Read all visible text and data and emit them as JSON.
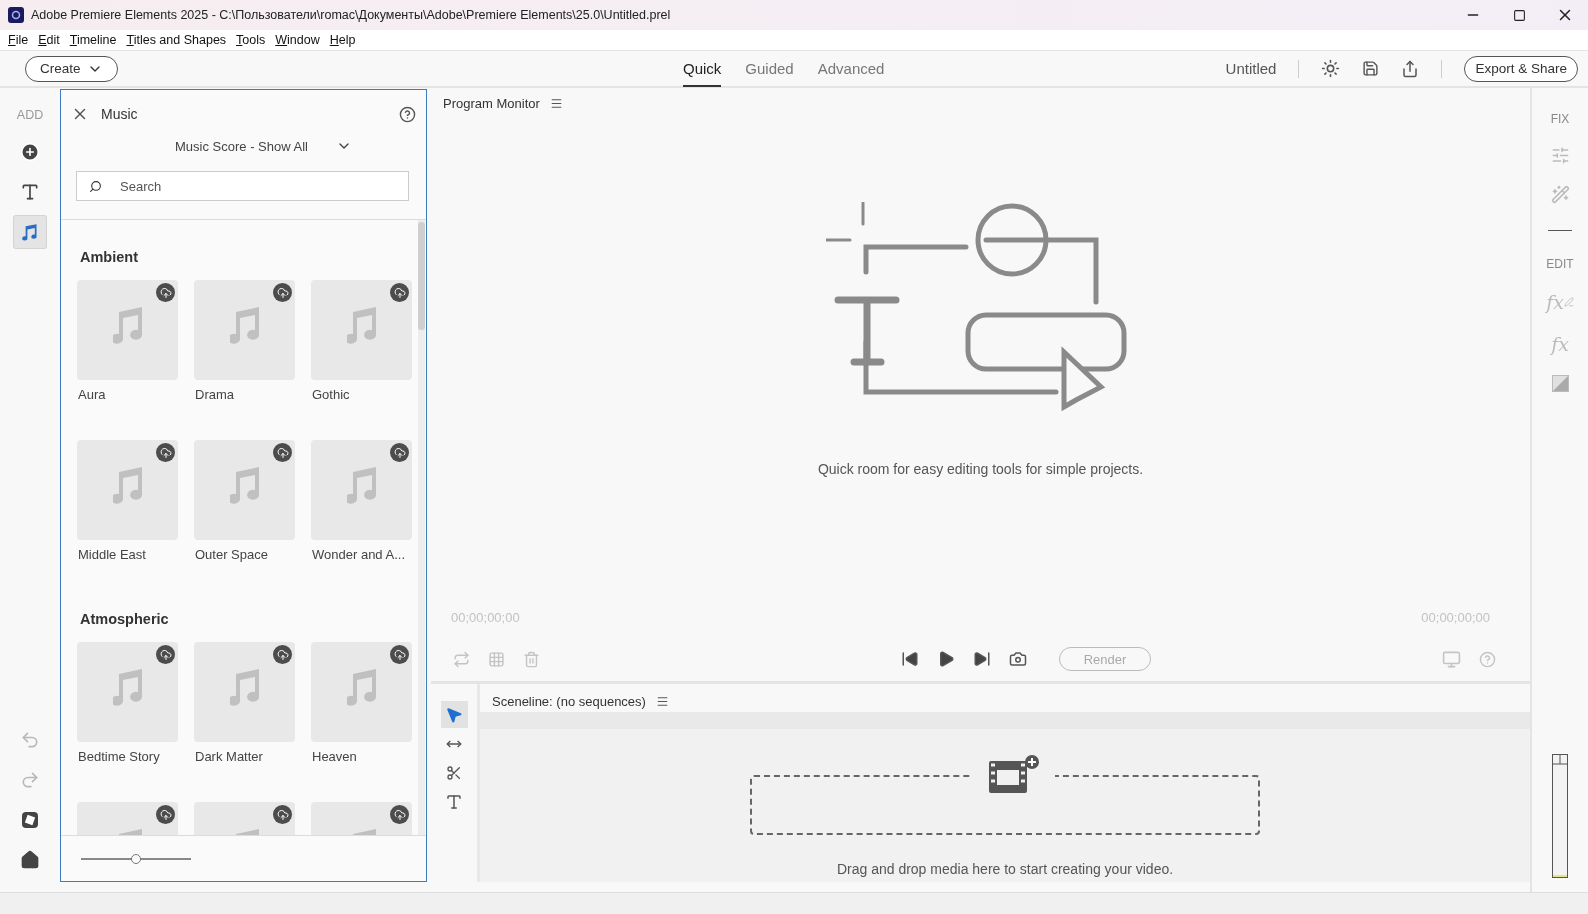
{
  "window": {
    "title": "Adobe Premiere Elements 2025 - C:\\Пользователи\\romac\\Документы\\Adobe\\Premiere Elements\\25.0\\Untitled.prel"
  },
  "menu": [
    "File",
    "Edit",
    "Timeline",
    "Titles and Shapes",
    "Tools",
    "Window",
    "Help"
  ],
  "toolbar": {
    "create": "Create",
    "modes": [
      {
        "label": "Quick",
        "selected": true
      },
      {
        "label": "Guided",
        "selected": false
      },
      {
        "label": "Advanced",
        "selected": false
      }
    ],
    "project": "Untitled",
    "export": "Export & Share"
  },
  "left_rail": {
    "label": "ADD",
    "items": [
      {
        "kind": "add",
        "selected": false
      },
      {
        "kind": "title",
        "selected": false
      },
      {
        "kind": "music",
        "selected": true
      }
    ],
    "bottom_items": [
      {
        "kind": "undo",
        "disabled": true
      },
      {
        "kind": "redo",
        "disabled": true
      },
      {
        "kind": "badge",
        "disabled": false
      },
      {
        "kind": "home",
        "disabled": false
      }
    ]
  },
  "panel": {
    "title": "Music",
    "filter": "Music Score - Show All",
    "search": {
      "placeholder": "Search"
    },
    "categories": [
      {
        "name": "Ambient",
        "tracks": [
          {
            "kind": "tile",
            "name": "Aura"
          },
          {
            "kind": "tile",
            "name": "Drama"
          },
          {
            "kind": "tile",
            "name": "Gothic"
          },
          {
            "kind": "tile",
            "name": "Middle East"
          },
          {
            "kind": "tile",
            "name": "Outer Space"
          },
          {
            "kind": "tile",
            "name": "Wonder and A..."
          }
        ]
      },
      {
        "name": "Atmospheric",
        "tracks": [
          {
            "kind": "tile",
            "name": "Bedtime Story"
          },
          {
            "kind": "tile",
            "name": "Dark Matter"
          },
          {
            "kind": "tile",
            "name": "Heaven"
          },
          {
            "kind": "clipped"
          },
          {
            "kind": "clipped"
          },
          {
            "kind": "clipped"
          }
        ]
      }
    ],
    "zoom": {
      "level": 0.5
    }
  },
  "monitor": {
    "title": "Program Monitor",
    "message": "Quick room for easy editing tools for simple projects.",
    "time_start": "00;00;00;00",
    "time_end": "00;00;00;00",
    "render": "Render"
  },
  "sceneline": {
    "title": "Sceneline: (no sequences)",
    "tools": [
      {
        "kind": "select",
        "selected": true
      },
      {
        "kind": "split",
        "selected": false
      },
      {
        "kind": "cut",
        "selected": false
      },
      {
        "kind": "text",
        "selected": false
      }
    ],
    "drop_text": "Drag and drop media here to start creating your video."
  },
  "right_rail": {
    "sections": [
      {
        "label": "FIX",
        "items": [
          {
            "kind": "adjust"
          },
          {
            "kind": "tools"
          }
        ]
      },
      {
        "label": "EDIT",
        "items": [
          {
            "kind": "fx-pen",
            "glyph": "fx"
          },
          {
            "kind": "fx",
            "glyph": "fx"
          },
          {
            "kind": "matte"
          }
        ]
      }
    ]
  }
}
